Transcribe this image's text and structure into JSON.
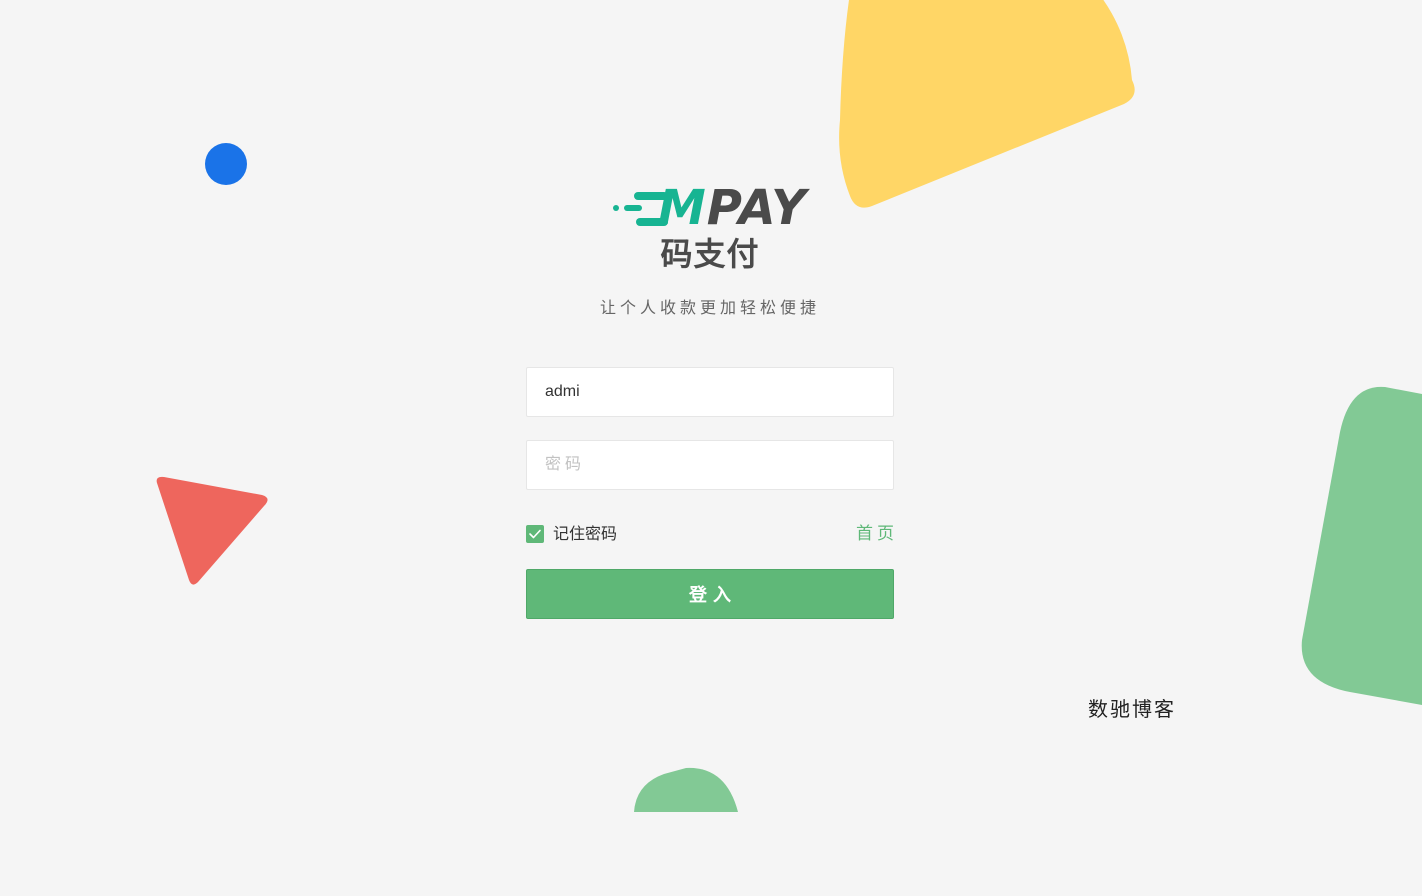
{
  "brand": {
    "logo_m": "M",
    "logo_rest": "PAY",
    "logo_cn": "码支付",
    "slogan": "让个人收款更加轻松便捷",
    "accent_color": "#17b492",
    "logo_text_color": "#4a4a4a"
  },
  "login_form": {
    "username_value": "admi",
    "password_placeholder": "密码",
    "remember_label": "记住密码",
    "remember_checked": true,
    "home_link": "首页",
    "submit_label": "登入"
  },
  "footer": {
    "site_name": "数驰博客"
  },
  "colors": {
    "background": "#f5f5f5",
    "primary_green": "#5fb878",
    "deco_yellow": "#ffd666",
    "deco_blue": "#1a73e8",
    "deco_red": "#ee665d",
    "deco_green": "#82c995"
  },
  "icons": {
    "checkbox": "check-icon",
    "logo_speed_lines": "speed-lines-icon"
  }
}
